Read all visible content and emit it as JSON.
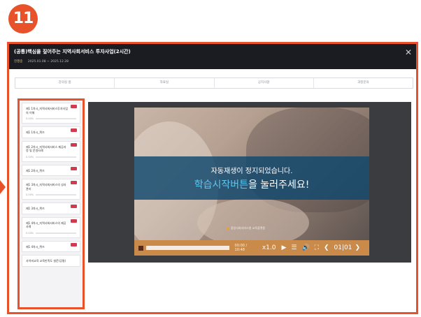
{
  "badge": {
    "number": "11"
  },
  "window": {
    "title": "(공통)핵심을 짚어주는 지역사회서비스 투자사업(2시간)",
    "status": "진행중",
    "period": "2025.01.08 ~ 2025.12.28",
    "close_glyph": "✕"
  },
  "tabs": [
    {
      "label": "강의실 홈"
    },
    {
      "label": "자료실"
    },
    {
      "label": "공지사항"
    },
    {
      "label": "과정문의"
    }
  ],
  "lessons": [
    {
      "name": "제1 1차시_지역사회서비스투자사업의 이해",
      "percent": "0.00%"
    },
    {
      "name": "제1 1차시_퀴즈",
      "percent": ""
    },
    {
      "name": "제1 2차시_지역사회서비스 제공과정 및 운영사례",
      "percent": "0.00%"
    },
    {
      "name": "제1 2차시_퀴즈",
      "percent": ""
    },
    {
      "name": "제1 3차시_지역사회서비스의 성과관리",
      "percent": "0.00%"
    },
    {
      "name": "제1 3차시_퀴즈",
      "percent": ""
    },
    {
      "name": "제1 4차시_지역사회서비스의 제공사례",
      "percent": "0.00%"
    },
    {
      "name": "제1 4차시_퀴즈",
      "percent": ""
    },
    {
      "name": "사이버교육 교육만족도 설문(공통)",
      "percent": ""
    }
  ],
  "player": {
    "overlay_line1": "자동재생이 정지되었습니다.",
    "overlay_line2_highlight": "학습시작버튼",
    "overlay_line2_rest": "을 눌러주세요!",
    "brand": "중앙사회서비스원 교육플랫폼",
    "time": "00:00 / 10:48",
    "speed": "x1.0",
    "page": "01|01",
    "icons": [
      "stop-icon",
      "play-icon",
      "menu-icon",
      "volume-icon",
      "fullscreen-icon",
      "prev-page-icon",
      "next-page-icon"
    ]
  },
  "colors": {
    "accent": "#e8522a",
    "topbar": "#1a1c22",
    "control_bar": "#c98a4a",
    "highlight_text": "#5cc8f2"
  }
}
